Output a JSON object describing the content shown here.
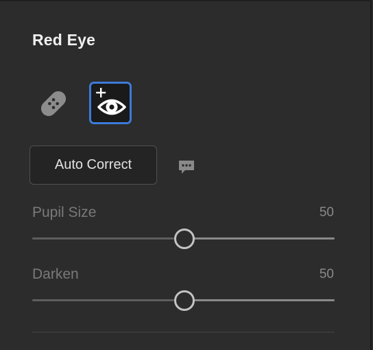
{
  "panel": {
    "title": "Red Eye"
  },
  "tools": [
    {
      "name": "healing",
      "icon": "bandage-icon",
      "active": false
    },
    {
      "name": "red-eye",
      "icon": "red-eye-plus-icon",
      "active": true
    }
  ],
  "auto_correct": {
    "label": "Auto Correct"
  },
  "feedback": {
    "icon": "speech-bubble-icon"
  },
  "sliders": [
    {
      "label": "Pupil Size",
      "value": "50",
      "level": 0.5
    },
    {
      "label": "Darken",
      "value": "50",
      "level": 0.5
    }
  ],
  "colors": {
    "accent": "#3c7bdb",
    "panel_bg": "#2c2c2c",
    "button_bg": "#242424"
  }
}
